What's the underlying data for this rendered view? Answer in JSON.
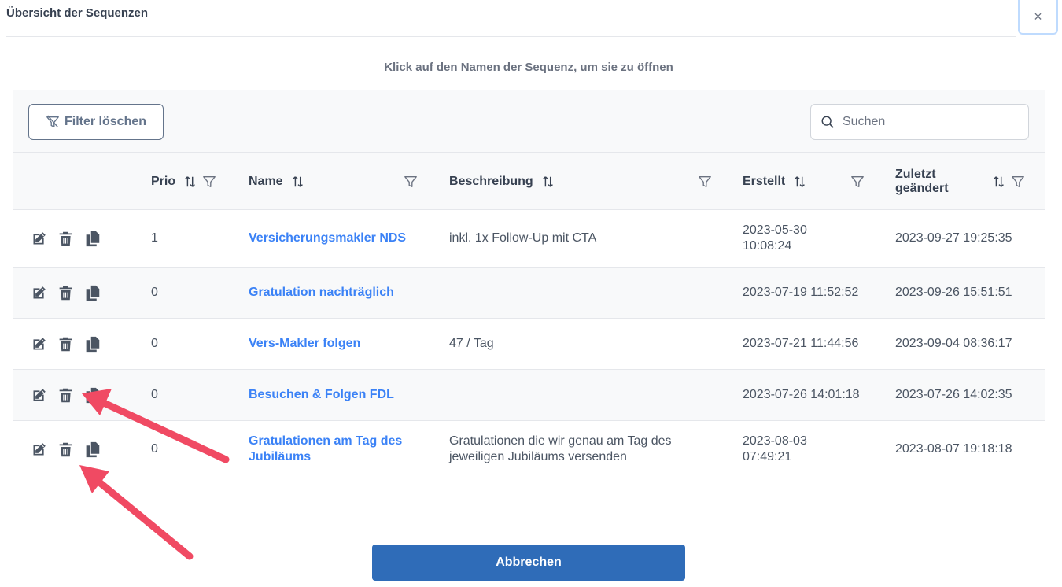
{
  "dialog": {
    "title": "Übersicht der Sequenzen",
    "close_label": "×",
    "hint": "Klick auf den Namen der Sequenz, um sie zu öffnen"
  },
  "toolbar": {
    "filter_clear_label": "Filter löschen",
    "search_placeholder": "Suchen",
    "search_value": ""
  },
  "table": {
    "headers": {
      "prio": "Prio",
      "name": "Name",
      "beschreibung": "Beschreibung",
      "erstellt": "Erstellt",
      "zuletzt_line1": "Zuletzt",
      "zuletzt_line2": "geändert"
    },
    "rows": [
      {
        "prio": "1",
        "name": "Versicherungsmakler NDS",
        "beschreibung": "inkl. 1x Follow-Up mit CTA",
        "erstellt_line1": "2023-05-30",
        "erstellt_line2": "10:08:24",
        "zuletzt": "2023-09-27 19:25:35"
      },
      {
        "prio": "0",
        "name": "Gratulation nachträglich",
        "beschreibung": "",
        "erstellt_line1": "2023-07-19 11:52:52",
        "erstellt_line2": "",
        "zuletzt": "2023-09-26 15:51:51"
      },
      {
        "prio": "0",
        "name": "Vers-Makler folgen",
        "beschreibung": "47 / Tag",
        "erstellt_line1": "2023-07-21 11:44:56",
        "erstellt_line2": "",
        "zuletzt": "2023-09-04 08:36:17"
      },
      {
        "prio": "0",
        "name": "Besuchen & Folgen FDL",
        "beschreibung": "",
        "erstellt_line1": "2023-07-26 14:01:18",
        "erstellt_line2": "",
        "zuletzt": "2023-07-26 14:02:35"
      },
      {
        "prio": "0",
        "name_line1": "Gratulationen am Tag des",
        "name_line2": "Jubiläums",
        "beschreibung_line1": "Gratulationen die wir genau am Tag des",
        "beschreibung_line2": "jeweiligen Jubiläums versenden",
        "erstellt_line1": "2023-08-03",
        "erstellt_line2": "07:49:21",
        "zuletzt": "2023-08-07 19:18:18"
      }
    ]
  },
  "footer": {
    "cancel_label": "Abbrechen"
  },
  "colors": {
    "link": "#3b82f6",
    "primary_button": "#2f6cb8",
    "annotation_arrow": "#f04a63"
  }
}
